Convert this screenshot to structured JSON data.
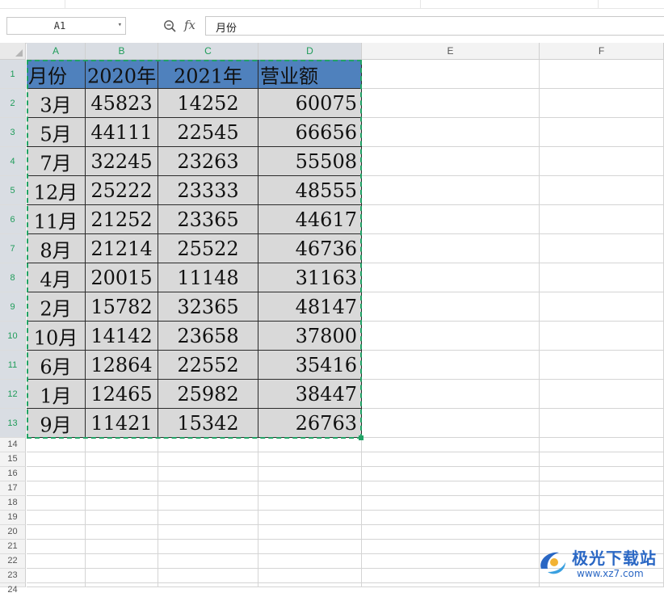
{
  "formula_bar": {
    "name_box": "A1",
    "fx_label": "fx",
    "formula_value": "月份"
  },
  "icons": {
    "zoom": "zoom-in-icon",
    "name_box_dropdown": "chevron-down-icon",
    "select_all": "select-all-triangle-icon"
  },
  "columns": [
    "A",
    "B",
    "C",
    "D",
    "E",
    "F"
  ],
  "rows": [
    "1",
    "2",
    "3",
    "4",
    "5",
    "6",
    "7",
    "8",
    "9",
    "10",
    "11",
    "12",
    "13",
    "14",
    "15",
    "16",
    "17",
    "18",
    "19",
    "20",
    "21",
    "22",
    "23",
    "24"
  ],
  "table": {
    "header": [
      "月份",
      "2020年",
      "2021年",
      "营业额"
    ],
    "body": [
      [
        "3月",
        "45823",
        "14252",
        "60075"
      ],
      [
        "5月",
        "44111",
        "22545",
        "66656"
      ],
      [
        "7月",
        "32245",
        "23263",
        "55508"
      ],
      [
        "12月",
        "25222",
        "23333",
        "48555"
      ],
      [
        "11月",
        "21252",
        "23365",
        "44617"
      ],
      [
        "8月",
        "21214",
        "25522",
        "46736"
      ],
      [
        "4月",
        "20015",
        "11148",
        "31163"
      ],
      [
        "2月",
        "15782",
        "32365",
        "48147"
      ],
      [
        "10月",
        "14142",
        "23658",
        "37800"
      ],
      [
        "6月",
        "12864",
        "22552",
        "35416"
      ],
      [
        "1月",
        "12465",
        "25982",
        "38447"
      ],
      [
        "9月",
        "11421",
        "15342",
        "26763"
      ]
    ]
  },
  "colors": {
    "header_fill": "#4f81bd",
    "body_fill": "#d9d9d9",
    "selection": "#21a366"
  },
  "watermark": {
    "brand": "极光下载站",
    "site": "www.xz7.com"
  }
}
